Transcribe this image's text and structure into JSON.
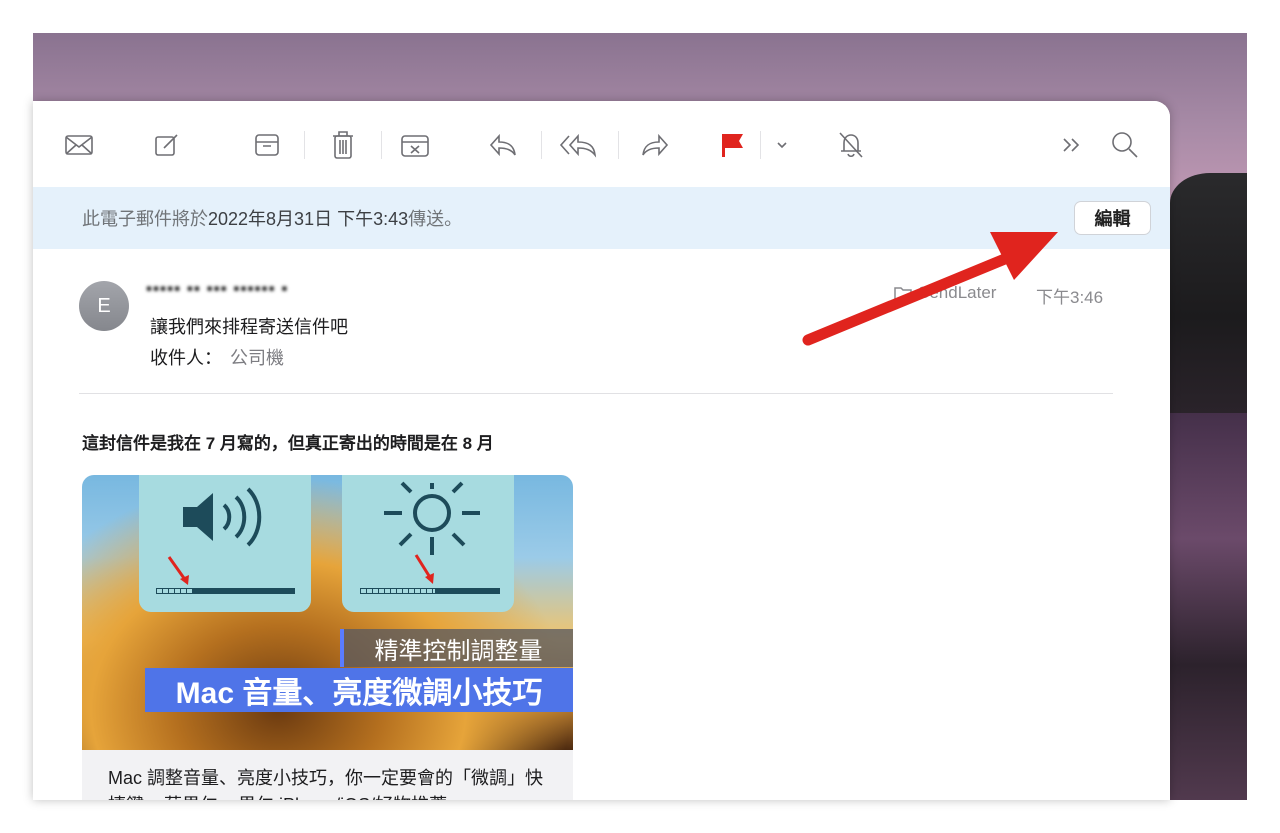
{
  "toolbar": {
    "icons": [
      "envelope-icon",
      "compose-icon",
      "archive-icon",
      "trash-icon",
      "junk-icon",
      "reply-icon",
      "reply-all-icon",
      "forward-icon",
      "flag-icon",
      "chevron-down-icon",
      "bell-slash-icon",
      "overflow-icon",
      "search-icon"
    ],
    "flag_color": "#e0241e"
  },
  "banner": {
    "prefix": "此電子郵件將於",
    "datetime": "2022年8月31日 下午3:43",
    "suffix": "傳送。",
    "edit_label": "編輯"
  },
  "message": {
    "avatar_initial": "E",
    "sender": "▪▪▪▪▪ ▪▪ ▪▪▪ ▪▪▪▪▪▪ ▪",
    "subject": "讓我們來排程寄送信件吧",
    "to_label": "收件人：",
    "to_value": "公司機",
    "mailbox": "SendLater",
    "time": "下午3:46",
    "body": "這封信件是我在 7 月寫的，但真正寄出的時間是在 8 月"
  },
  "card": {
    "tagline": "精準控制調整量",
    "headline": "Mac 音量、亮度微調小技巧",
    "caption": "Mac 調整音量、亮度小技巧，你一定要會的「微調」快捷鍵 – 蘋果仁 – 果仁 iPhone/iOS/好物推薦"
  },
  "colors": {
    "banner_bg": "#e5f1fb",
    "annotation_arrow": "#e0241e",
    "headline_bg": "#4f74e8"
  }
}
